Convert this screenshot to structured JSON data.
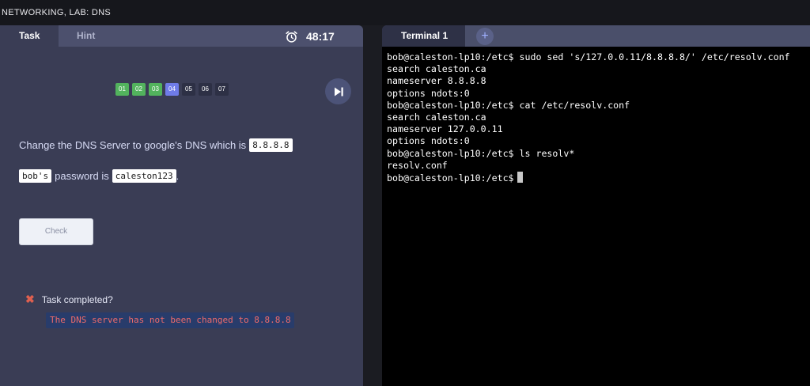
{
  "window": {
    "title": "NETWORKING, LAB: DNS"
  },
  "left_panel": {
    "tabs": [
      {
        "label": "Task",
        "active": true
      },
      {
        "label": "Hint",
        "active": false
      }
    ],
    "timer": "48:17",
    "steps": [
      {
        "label": "01",
        "state": "done"
      },
      {
        "label": "02",
        "state": "done"
      },
      {
        "label": "03",
        "state": "done"
      },
      {
        "label": "04",
        "state": "current"
      },
      {
        "label": "05",
        "state": "pending"
      },
      {
        "label": "06",
        "state": "pending"
      },
      {
        "label": "07",
        "state": "pending"
      }
    ],
    "task_text": "Change the DNS Server to google's DNS which is",
    "task_code": "8.8.8.8",
    "password_user": "bob's",
    "password_text": "password is",
    "password_value": "caleston123",
    "password_suffix": ".",
    "check_button": "Check",
    "completed_label": "Task completed?",
    "error_message": "The DNS server has not been changed to 8.8.8.8"
  },
  "terminal": {
    "tab_label": "Terminal 1",
    "add_tab": "+",
    "lines": [
      "bob@caleston-lp10:/etc$ sudo sed 's/127.0.0.11/8.8.8.8/' /etc/resolv.conf",
      "search caleston.ca",
      "nameserver 8.8.8.8",
      "options ndots:0",
      "bob@caleston-lp10:/etc$ cat /etc/resolv.conf",
      "search caleston.ca",
      "nameserver 127.0.0.11",
      "options ndots:0",
      "bob@caleston-lp10:/etc$ ls resolv*",
      "resolv.conf"
    ],
    "prompt": "bob@caleston-lp10:/etc$"
  },
  "colors": {
    "step_done": "#52b35d",
    "step_current": "#6f7ce8",
    "step_pending": "#2d3045",
    "error_text": "#ef6b6b",
    "error_bg": "#283c6b",
    "x_icon": "#e0604f"
  },
  "icons": [
    "alarm-clock-icon",
    "skip-forward-icon",
    "close-x-icon",
    "plus-icon"
  ]
}
